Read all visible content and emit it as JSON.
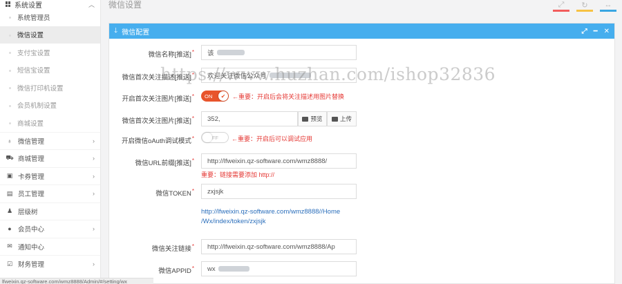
{
  "sidebar": {
    "group_title": "系统设置",
    "sub_items": [
      {
        "label": "系统管理员"
      },
      {
        "label": "微信设置"
      },
      {
        "label": "支付宝设置"
      },
      {
        "label": "短信宝设置"
      },
      {
        "label": "微信打印机设置"
      },
      {
        "label": "会员机制设置"
      },
      {
        "label": "商城设置"
      }
    ],
    "items": [
      {
        "label": "微信管理",
        "icon": "wechat-icon"
      },
      {
        "label": "商城管理",
        "icon": "cart-icon"
      },
      {
        "label": "卡券管理",
        "icon": "ticket-icon"
      },
      {
        "label": "员工管理",
        "icon": "staff-icon"
      },
      {
        "label": "层级树",
        "icon": "bell-icon"
      },
      {
        "label": "会员中心",
        "icon": "user-icon"
      },
      {
        "label": "通知中心",
        "icon": "mail-icon"
      },
      {
        "label": "财务管理",
        "icon": "finance-icon"
      }
    ]
  },
  "header": {
    "page_title": "微信设置",
    "accent_colors": [
      "#f25c5c",
      "#f7c243",
      "#3aa6e2"
    ]
  },
  "panel": {
    "title": "微信配置",
    "color": "#46aeee"
  },
  "form": {
    "wechat_name": {
      "label": "微信名称[推送]",
      "value": "该"
    },
    "first_follow_desc": {
      "label": "微信首次关注描述[推送]",
      "value": "欢迎关注微信公众号"
    },
    "first_follow_img_switch": {
      "label": "开启首次关注图片[推送]",
      "state": "ON",
      "hint": "←重要：开启后会将关注描述用图片替换"
    },
    "first_follow_img": {
      "label": "微信首次关注图片[推送]",
      "value": "352,",
      "preview_label": "预览",
      "upload_label": "上传"
    },
    "oauth_switch": {
      "label": "开启微信oAuth调试模式",
      "state": "OFF",
      "hint": "←重要：开启后可以调试应用"
    },
    "url_prefix": {
      "label": "微信URL前缀[推送]",
      "value": "http://lfweixin.qz-software.com/wmz8888/",
      "hint": "重要：链接需要添加 http://"
    },
    "token": {
      "label": "微信TOKEN",
      "value": "zxjsjk",
      "link_line1": "http://lfweixin.qz-software.com/wmz8888//Home",
      "link_line2": "/Wx/index/token/zxjsjk"
    },
    "follow_link": {
      "label": "微信关注链接",
      "value": "http://lfweixin.qz-software.com/wmz8888/Ap"
    },
    "appid": {
      "label": "微信APPID",
      "value": "wx"
    }
  },
  "watermark": "https://www.huzhan.com/ishop32836",
  "status_url": "lfweixin.qz-software.com/wmz8888/Admin/#/setting/wx"
}
